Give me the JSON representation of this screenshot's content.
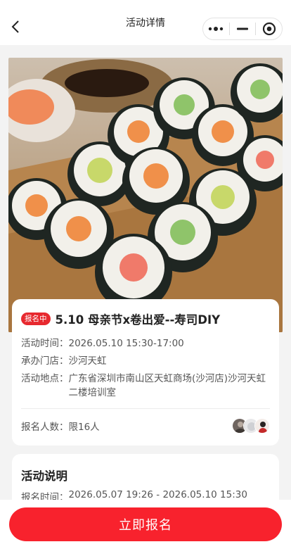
{
  "nav": {
    "title": "活动详情"
  },
  "event": {
    "status_badge": "报名中",
    "title": "5.10 母亲节x卷出爱--寿司DIY",
    "time_label": "活动时间：",
    "time_value": "2026.05.10 15:30-17:00",
    "store_label": "承办门店：",
    "store_value": "沙河天虹",
    "location_label": "活动地点：",
    "location_value": "广东省深圳市南山区天虹商场(沙河店)沙河天虹二楼培训室",
    "signup_label": "报名人数：",
    "signup_value": "限16人"
  },
  "description": {
    "title": "活动说明",
    "signup_time_label": "报名时间：",
    "signup_time_value": "2026.05.07 19:26 - 2026.05.10 15:30"
  },
  "footer": {
    "signup_button": "立即报名"
  },
  "colors": {
    "accent": "#f8222d",
    "badge": "#e7292f"
  },
  "icons": {
    "back": "chevron-left-icon",
    "more": "more-dots-icon",
    "minimize": "minimize-icon",
    "close": "target-close-icon"
  }
}
